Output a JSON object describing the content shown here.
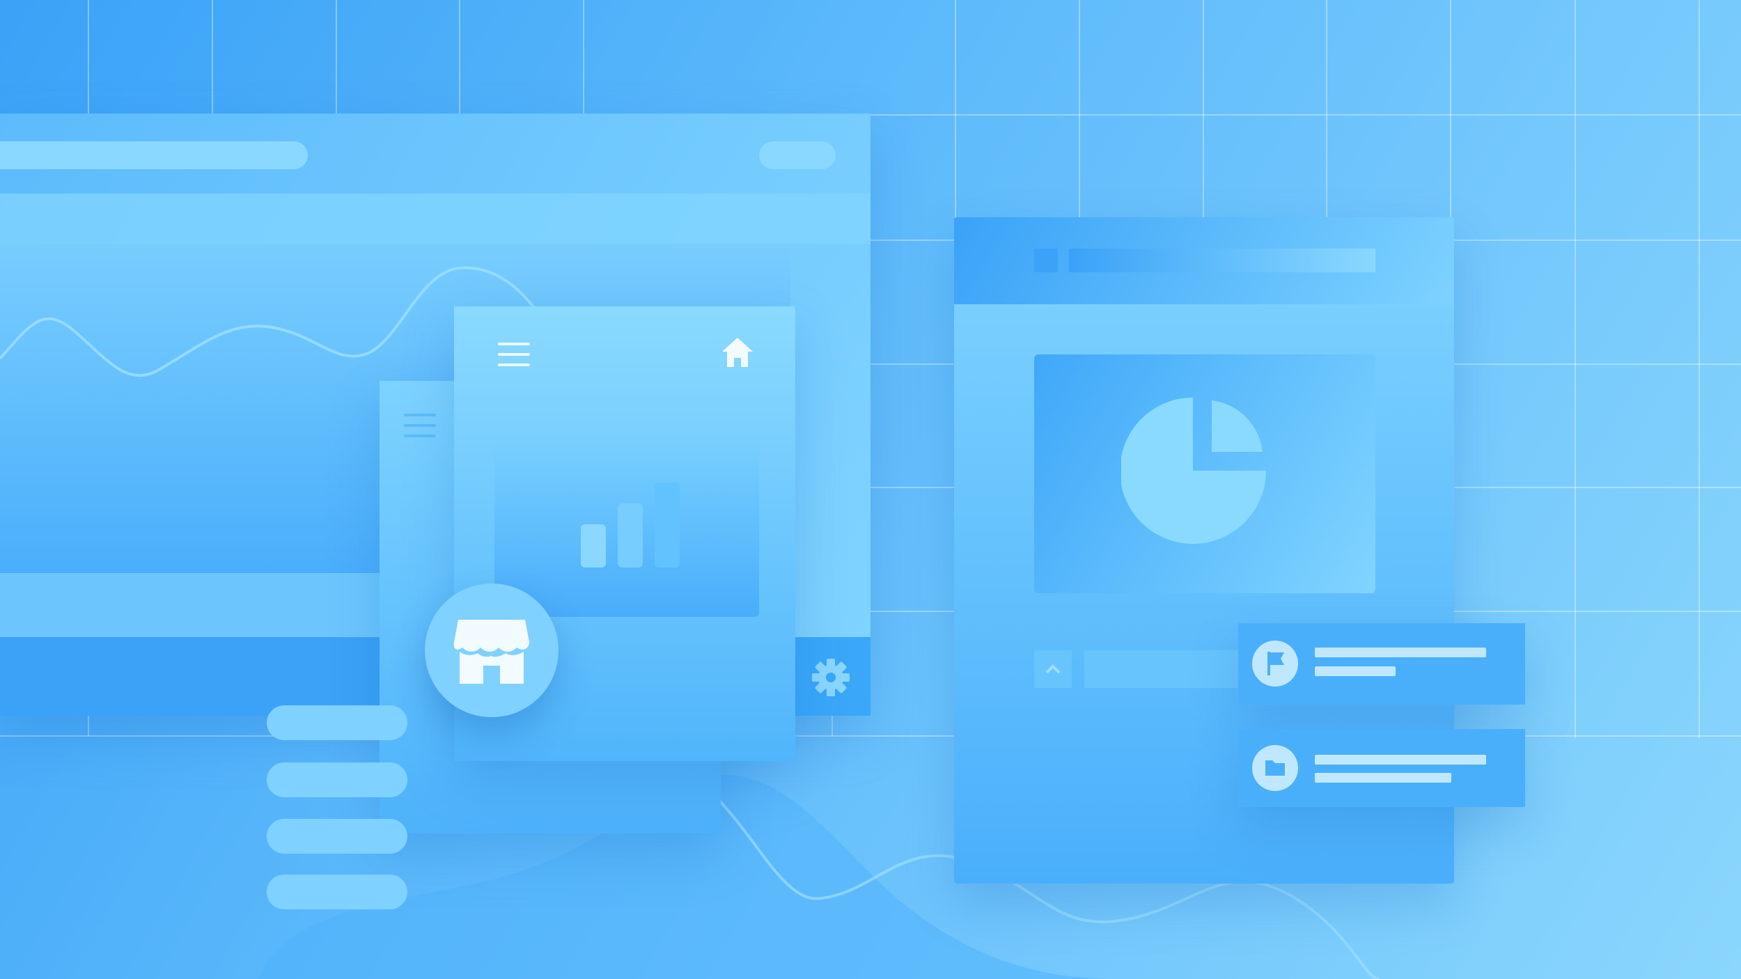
{
  "colors": {
    "bg_start": "#3aa2f7",
    "bg_end": "#8ad6fd",
    "panel_light": "#7dd2ff",
    "panel_mid": "#5bbbfb",
    "accent": "#3aa2f7",
    "icon_light": "#aee3ff"
  },
  "icons": {
    "left_menu": "hamburger-icon",
    "home": "home-icon",
    "back_menu": "hamburger-icon",
    "chart": "bar-chart-icon",
    "store": "storefront-icon",
    "settings": "gear-icon",
    "pie": "pie-chart-icon",
    "collapse": "chevron-up-icon",
    "flag": "flag-icon",
    "folder": "folder-icon"
  }
}
